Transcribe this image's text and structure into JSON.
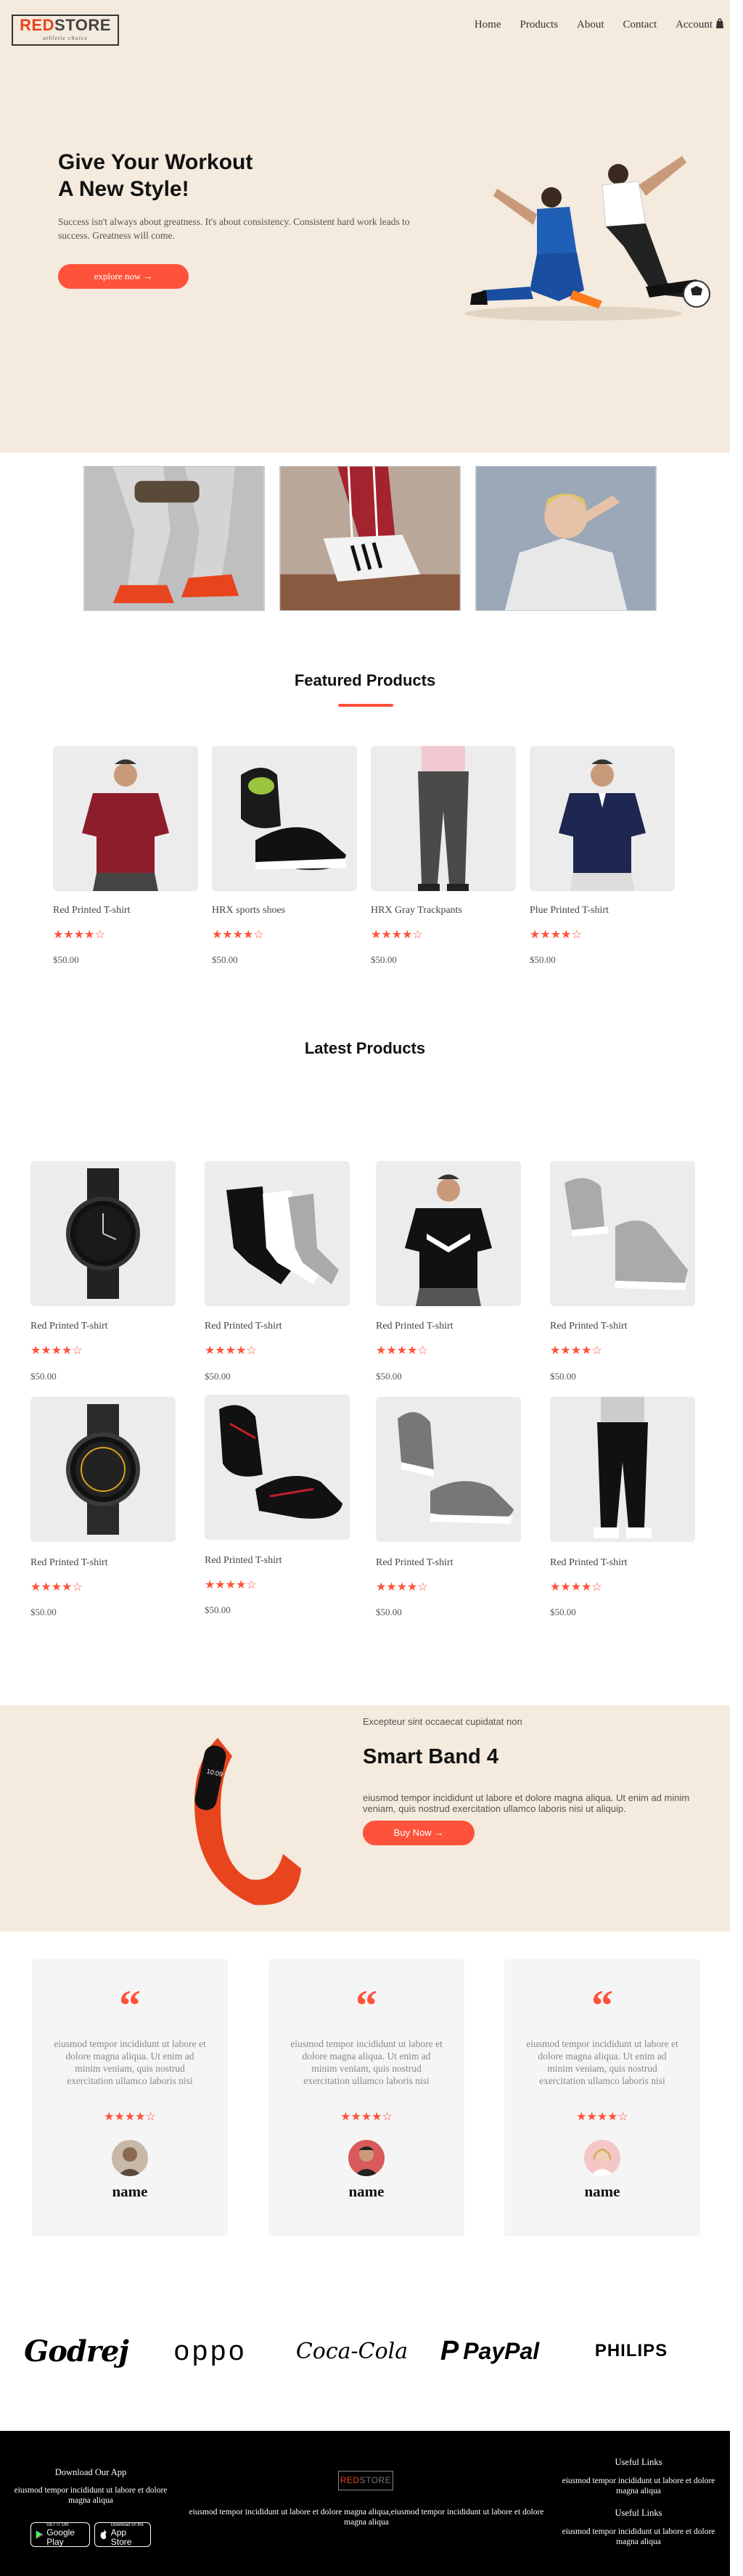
{
  "header": {
    "logo_red": "RED",
    "logo_dark": "STORE",
    "logo_tagline": "athletic choice",
    "nav": [
      "Home",
      "Products",
      "About",
      "Contact",
      "Account"
    ],
    "cart_icon": "cart-icon"
  },
  "hero": {
    "title_line1": "Give Your Workout",
    "title_line2": "A New Style!",
    "text": "Success isn't always about greatness. It's about consistency. Consistent hard work leads to success. Greatness will come.",
    "button": "explore now →"
  },
  "featured": {
    "title": "Featured Products",
    "products": [
      {
        "name": "Red Printed T-shirt",
        "rating": 4,
        "price": "$50.00"
      },
      {
        "name": "HRX sports shoes",
        "rating": 4,
        "price": "$50.00"
      },
      {
        "name": "HRX Gray Trackpants",
        "rating": 4,
        "price": "$50.00"
      },
      {
        "name": "Plue Printed T-shirt",
        "rating": 4,
        "price": "$50.00"
      }
    ]
  },
  "latest": {
    "title": "Latest Products",
    "products": [
      {
        "name": "Red Printed T-shirt",
        "rating": 4,
        "price": "$50.00"
      },
      {
        "name": "Red Printed T-shirt",
        "rating": 4,
        "price": "$50.00"
      },
      {
        "name": "Red Printed T-shirt",
        "rating": 4,
        "price": "$50.00"
      },
      {
        "name": "Red Printed T-shirt",
        "rating": 4,
        "price": "$50.00"
      },
      {
        "name": "Red Printed T-shirt",
        "rating": 4,
        "price": "$50.00"
      },
      {
        "name": "Red Printed T-shirt",
        "rating": 4,
        "price": "$50.00"
      },
      {
        "name": "Red Printed T-shirt",
        "rating": 4,
        "price": "$50.00"
      },
      {
        "name": "Red Printed T-shirt",
        "rating": 4,
        "price": "$50.00"
      }
    ]
  },
  "offer": {
    "subtitle": "Excepteur sint occaecat cupidatat non",
    "title": "Smart Band 4",
    "text": "eiusmod tempor incididunt ut labore et dolore magna aliqua. Ut enim ad minim veniam, quis nostrud exercitation ullamco laboris nisi ut aliquip.",
    "button": "Buy Now →"
  },
  "testimonials": [
    {
      "text": "eiusmod tempor incididunt ut labore et dolore magna aliqua. Ut enim ad minim veniam, quis nostrud exercitation ullamco laboris nisi",
      "rating": 4,
      "name": "name"
    },
    {
      "text": "eiusmod tempor incididunt ut labore et dolore magna aliqua. Ut enim ad minim veniam, quis nostrud exercitation ullamco laboris nisi",
      "rating": 4,
      "name": "name"
    },
    {
      "text": "eiusmod tempor incididunt ut labore et dolore magna aliqua. Ut enim ad minim veniam, quis nostrud exercitation ullamco laboris nisi",
      "rating": 4,
      "name": "name"
    }
  ],
  "brands": [
    "Godrej",
    "oppo",
    "Coca-Cola",
    "PayPal",
    "PHILIPS"
  ],
  "footer": {
    "download_title": "Download Our App",
    "download_text": "eiusmod tempor incididunt ut labore et dolore magna aliqua",
    "google_small": "GET IT ON",
    "google_big": "Google Play",
    "apple_small": "Download on the",
    "apple_big": "App Store",
    "logo_red": "RED",
    "logo_dark": "STORE",
    "center_text": "eiusmod tempor incididunt ut labore et dolore magna aliqua,eiusmod tempor incididunt ut labore et dolore magna aliqua",
    "links1_title": "Useful Links",
    "links1_text": "eiusmod tempor incididunt ut labore et dolore magna aliqua",
    "links2_title": "Useful Links",
    "links2_text": "eiusmod tempor incididunt ut labore et dolore magna aliqua"
  },
  "colors": {
    "accent": "#ff523b",
    "cream": "#f4eadd",
    "footer": "#000000"
  }
}
